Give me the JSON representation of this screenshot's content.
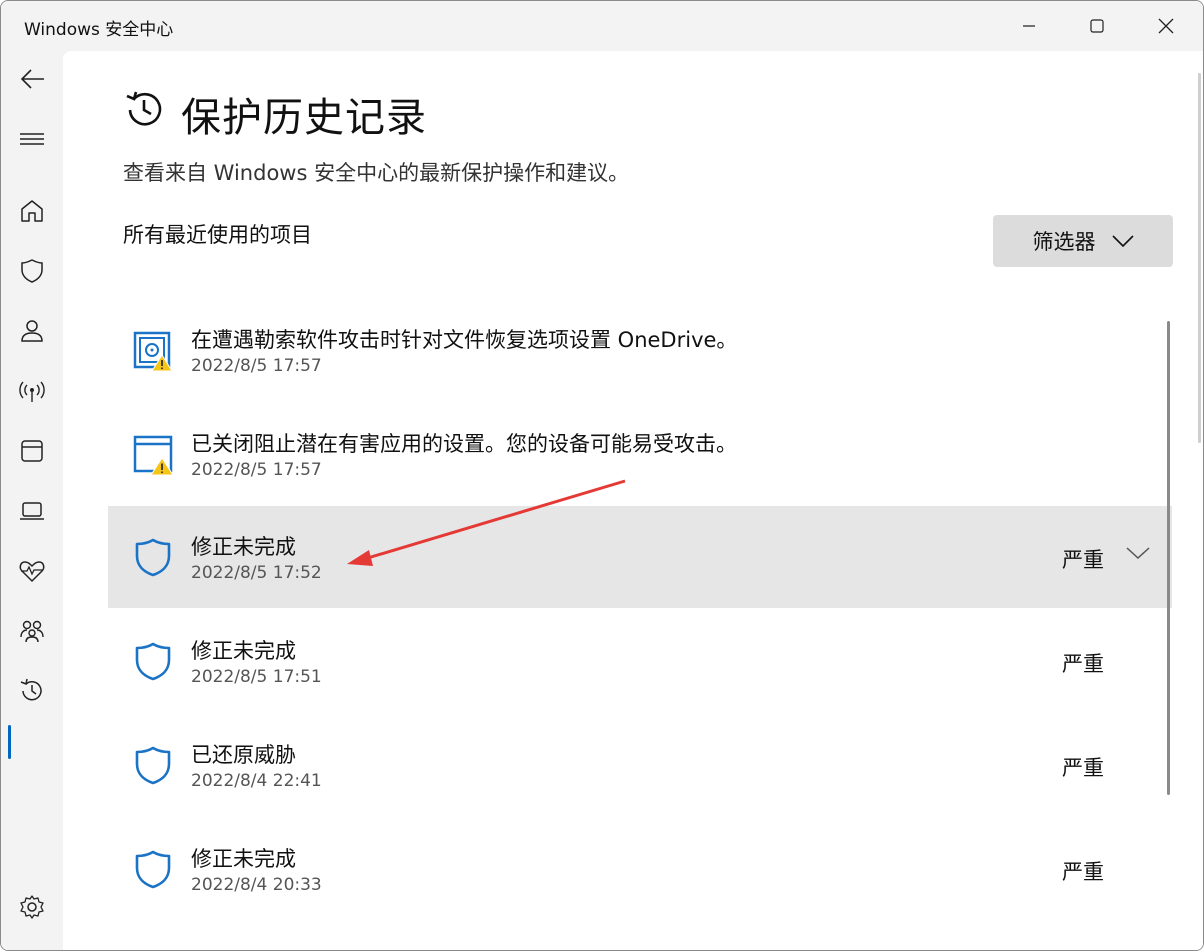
{
  "window": {
    "title": "Windows 安全中心"
  },
  "nav": {
    "items": [
      {
        "name": "back-icon"
      },
      {
        "name": "menu-icon"
      },
      {
        "name": "home-icon"
      },
      {
        "name": "shield-icon"
      },
      {
        "name": "account-icon"
      },
      {
        "name": "network-icon"
      },
      {
        "name": "app-browser-icon"
      },
      {
        "name": "device-icon"
      },
      {
        "name": "health-icon"
      },
      {
        "name": "family-icon"
      },
      {
        "name": "history-icon",
        "active": true
      },
      {
        "name": "settings-icon"
      }
    ]
  },
  "page": {
    "title": "保护历史记录",
    "subtitle": "查看来自 Windows 安全中心的最新保护操作和建议。",
    "section_label": "所有最近使用的项目",
    "filter_label": "筛选器"
  },
  "history": [
    {
      "title": "在遭遇勒索软件攻击时针对文件恢复选项设置 OneDrive。",
      "time": "2022/8/5 17:57",
      "severity": "",
      "icon": "vault-warning-icon"
    },
    {
      "title": "已关闭阻止潜在有害应用的设置。您的设备可能易受攻击。",
      "time": "2022/8/5 17:57",
      "severity": "",
      "icon": "app-warning-icon"
    },
    {
      "title": "修正未完成",
      "time": "2022/8/5 17:52",
      "severity": "严重",
      "icon": "shield-icon",
      "selected": true
    },
    {
      "title": "修正未完成",
      "time": "2022/8/5 17:51",
      "severity": "严重",
      "icon": "shield-icon"
    },
    {
      "title": "已还原威胁",
      "time": "2022/8/4 22:41",
      "severity": "严重",
      "icon": "shield-icon"
    },
    {
      "title": "修正未完成",
      "time": "2022/8/4 20:33",
      "severity": "严重",
      "icon": "shield-icon"
    }
  ],
  "colors": {
    "accent": "#0067c0",
    "icon_blue": "#1a73c6",
    "warning": "#f5c518",
    "annotation": "#e53935",
    "selected_bg": "#e6e6e6"
  }
}
